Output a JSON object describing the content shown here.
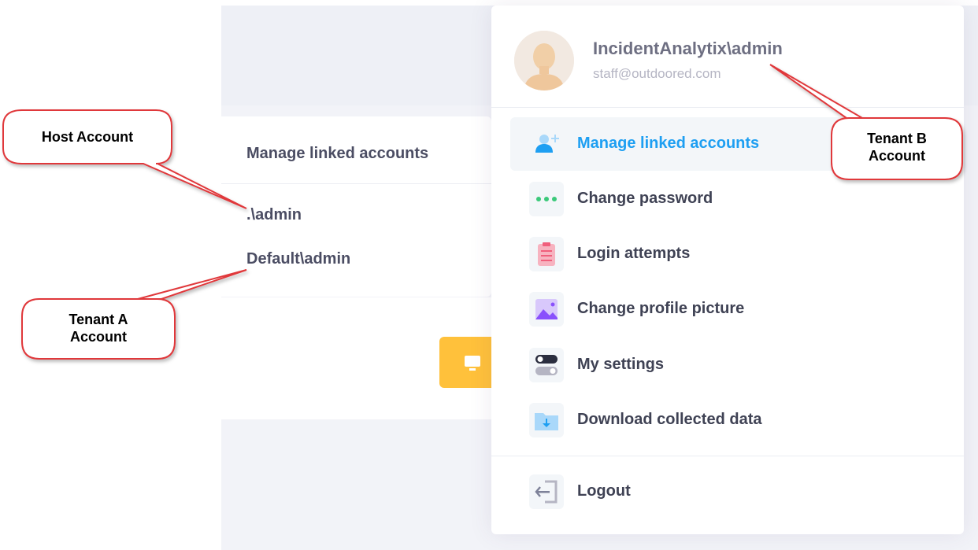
{
  "linked_panel": {
    "title": "Manage linked accounts",
    "accounts": [
      ".\\admin",
      "Default\\admin"
    ]
  },
  "user": {
    "name": "IncidentAnalytix\\admin",
    "email": "staff@outdoored.com"
  },
  "menu": [
    {
      "label": "Manage linked accounts",
      "icon": "add-user-icon",
      "active": true
    },
    {
      "label": "Change password",
      "icon": "dots-icon",
      "active": false
    },
    {
      "label": "Login attempts",
      "icon": "clipboard-icon",
      "active": false
    },
    {
      "label": "Change profile picture",
      "icon": "picture-icon",
      "active": false
    },
    {
      "label": "My settings",
      "icon": "toggle-icon",
      "active": false
    },
    {
      "label": "Download collected data",
      "icon": "download-folder-icon",
      "active": false
    },
    {
      "label": "Logout",
      "icon": "logout-icon",
      "active": false
    }
  ],
  "callouts": {
    "host": "Host Account",
    "tenant_a_line1": "Tenant A",
    "tenant_a_line2": "Account",
    "tenant_b_line1": "Tenant B",
    "tenant_b_line2": "Account"
  },
  "colors": {
    "accent": "#1e9ff2",
    "callout_border": "#e0383b",
    "button_yellow": "#ffc13b"
  }
}
